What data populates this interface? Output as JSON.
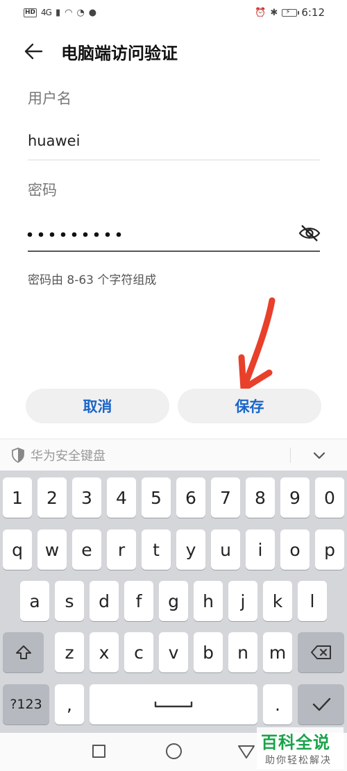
{
  "status_bar": {
    "hd": "HD",
    "network": "4G",
    "time": "6:12"
  },
  "header": {
    "title": "电脑端访问验证"
  },
  "form": {
    "username_label": "用户名",
    "username_value": "huawei",
    "password_label": "密码",
    "password_masked": "●●●●●●●●●",
    "password_hint": "密码由 8-63 个字符组成"
  },
  "buttons": {
    "cancel": "取消",
    "save": "保存"
  },
  "keyboard": {
    "title": "华为安全键盘",
    "row1": [
      "1",
      "2",
      "3",
      "4",
      "5",
      "6",
      "7",
      "8",
      "9",
      "0"
    ],
    "row2": [
      "q",
      "w",
      "e",
      "r",
      "t",
      "y",
      "u",
      "i",
      "o",
      "p"
    ],
    "row3": [
      "a",
      "s",
      "d",
      "f",
      "g",
      "h",
      "j",
      "k",
      "l"
    ],
    "row4": [
      "z",
      "x",
      "c",
      "v",
      "b",
      "n",
      "m"
    ],
    "symbols_key": "?123",
    "comma_key": ",",
    "period_key": "."
  },
  "watermark": {
    "main": "百科全说",
    "sub": "助你轻松解决"
  },
  "colors": {
    "accent": "#1a65c8",
    "annotation": "#e8402a",
    "watermark": "#1aa34a"
  }
}
